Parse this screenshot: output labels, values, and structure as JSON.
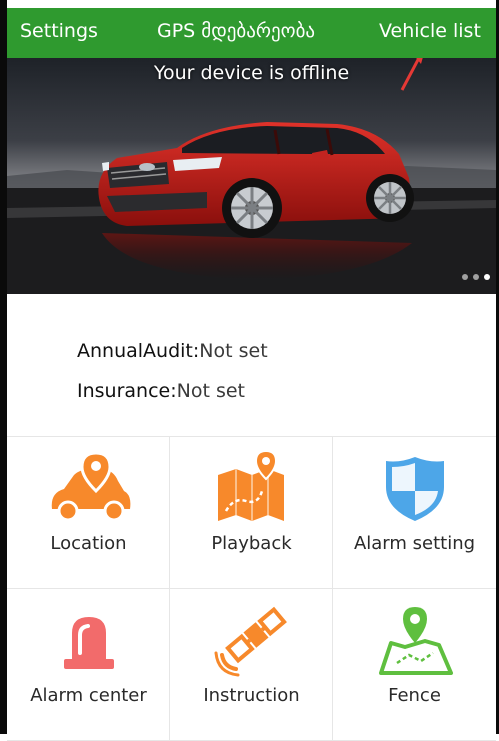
{
  "topbar": {
    "settings_label": "Settings",
    "gps_label": "GPS მდებარეობა",
    "vehicle_list_label": "Vehicle list"
  },
  "banner": {
    "status_text": "Your device is offline",
    "page_count": 3,
    "active_page": 3
  },
  "info": {
    "annual_audit_label": "AnnualAudit:",
    "annual_audit_value": "Not set",
    "insurance_label": "Insurance:",
    "insurance_value": "Not set"
  },
  "menu": {
    "items": [
      {
        "label": "Location",
        "icon": "car-location-pin-icon",
        "color": "#f7892b"
      },
      {
        "label": "Playback",
        "icon": "map-route-icon",
        "color": "#f7892b"
      },
      {
        "label": "Alarm setting",
        "icon": "shield-icon",
        "color": "#4da6e8"
      },
      {
        "label": "Alarm center",
        "icon": "siren-light-icon",
        "color": "#f26b6b"
      },
      {
        "label": "Instruction",
        "icon": "satellite-icon",
        "color": "#f7892b"
      },
      {
        "label": "Fence",
        "icon": "map-geofence-icon",
        "color": "#5fbf3f"
      }
    ]
  },
  "colors": {
    "header_green": "#2f9a2f",
    "arrow_red": "#e53935"
  }
}
